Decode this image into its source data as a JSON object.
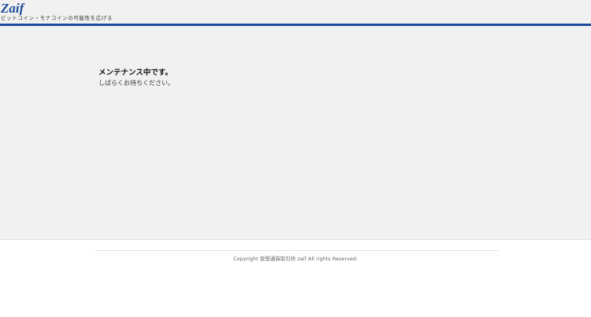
{
  "header": {
    "logo_text": "Zaif",
    "tagline": "ビットコイン・モナコインの可能性を広げる",
    "brand_color": "#1e4a9a"
  },
  "main": {
    "title": "メンテナンス中です。",
    "message": "しばらくお待ちください。"
  },
  "footer": {
    "copyright": "Copyright 仮想通貨取引所 zaif All rights Reserved."
  }
}
